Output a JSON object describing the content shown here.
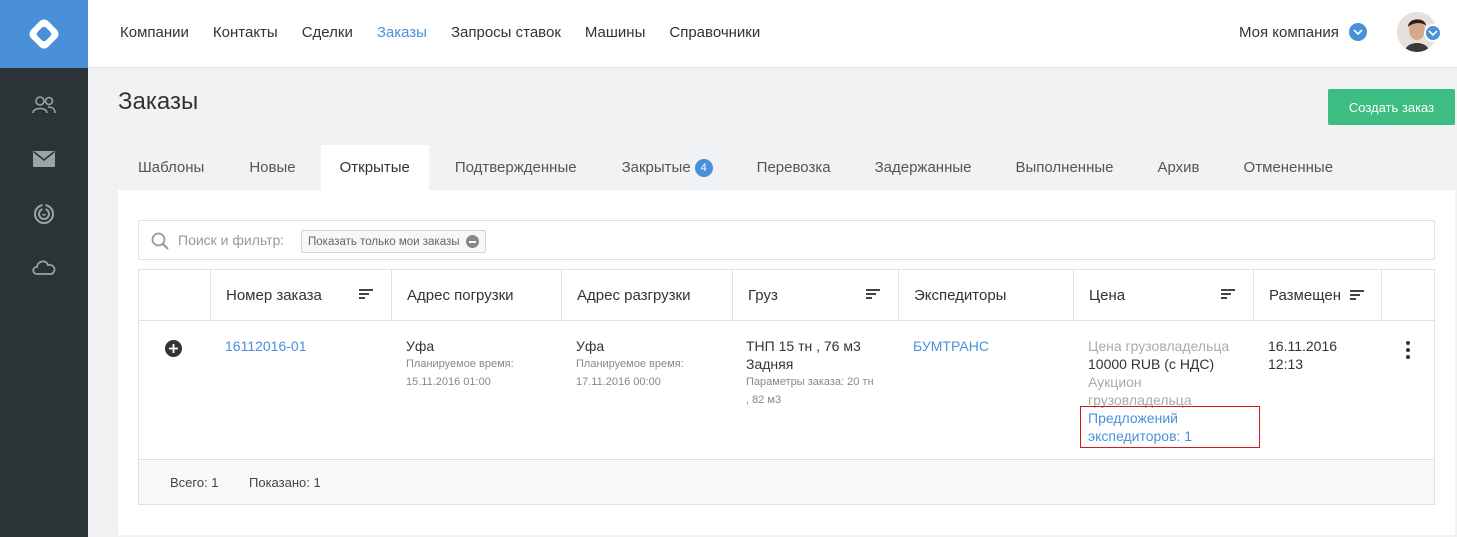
{
  "nav": {
    "items": [
      {
        "label": "Компании",
        "active": false
      },
      {
        "label": "Контакты",
        "active": false
      },
      {
        "label": "Сделки",
        "active": false
      },
      {
        "label": "Заказы",
        "active": true
      },
      {
        "label": "Запросы ставок",
        "active": false
      },
      {
        "label": "Машины",
        "active": false
      },
      {
        "label": "Справочники",
        "active": false
      }
    ],
    "company": "Моя компания"
  },
  "sidebar": {
    "icons": [
      "users-icon",
      "mail-icon",
      "radar-icon",
      "cloud-icon"
    ]
  },
  "page": {
    "title": "Заказы",
    "create_button": "Создать заказ"
  },
  "tabs": [
    {
      "label": "Шаблоны",
      "active": false
    },
    {
      "label": "Новые",
      "active": false
    },
    {
      "label": "Открытые",
      "active": true
    },
    {
      "label": "Подтвержденные",
      "active": false
    },
    {
      "label": "Закрытые",
      "active": false,
      "badge": "4"
    },
    {
      "label": "Перевозка",
      "active": false
    },
    {
      "label": "Задержанные",
      "active": false
    },
    {
      "label": "Выполненные",
      "active": false
    },
    {
      "label": "Архив",
      "active": false
    },
    {
      "label": "Отмененные",
      "active": false
    }
  ],
  "search": {
    "placeholder": "Поиск и фильтр:",
    "chip": "Показать только мои заказы"
  },
  "table": {
    "columns": [
      "Номер заказа",
      "Адрес погрузки",
      "Адрес разгрузки",
      "Груз",
      "Экспедиторы",
      "Цена",
      "Размещен"
    ],
    "row": {
      "order_number": "16112016-01",
      "load_city": "Уфа",
      "load_time_label": "Планируемое время:",
      "load_time": "15.11.2016 01:00",
      "unload_city": "Уфа",
      "unload_time_label": "Планируемое время:",
      "unload_time": "17.11.2016 00:00",
      "cargo_line1": "ТНП 15 тн , 76 м3",
      "cargo_line2": "Задняя",
      "cargo_params_1": "Параметры заказа: 20 тн",
      "cargo_params_2": ", 82 м3",
      "forwarder": "БУМТРАНС",
      "price_label": "Цена грузовладельца",
      "price_value": "10000 RUB (с НДС)",
      "auction_1": "Аукцион",
      "auction_2": "грузовладельца",
      "offers_1": "Предложений",
      "offers_2": "экспедиторов: 1",
      "placed_date": "16.11.2016",
      "placed_time": "12:13"
    },
    "footer": {
      "total": "Всего: 1",
      "shown": "Показано: 1"
    }
  },
  "colors": {
    "accent": "#4a90d9",
    "sidebar": "#2b3337",
    "create": "#3dbd82",
    "highlight": "#c81e1e"
  }
}
